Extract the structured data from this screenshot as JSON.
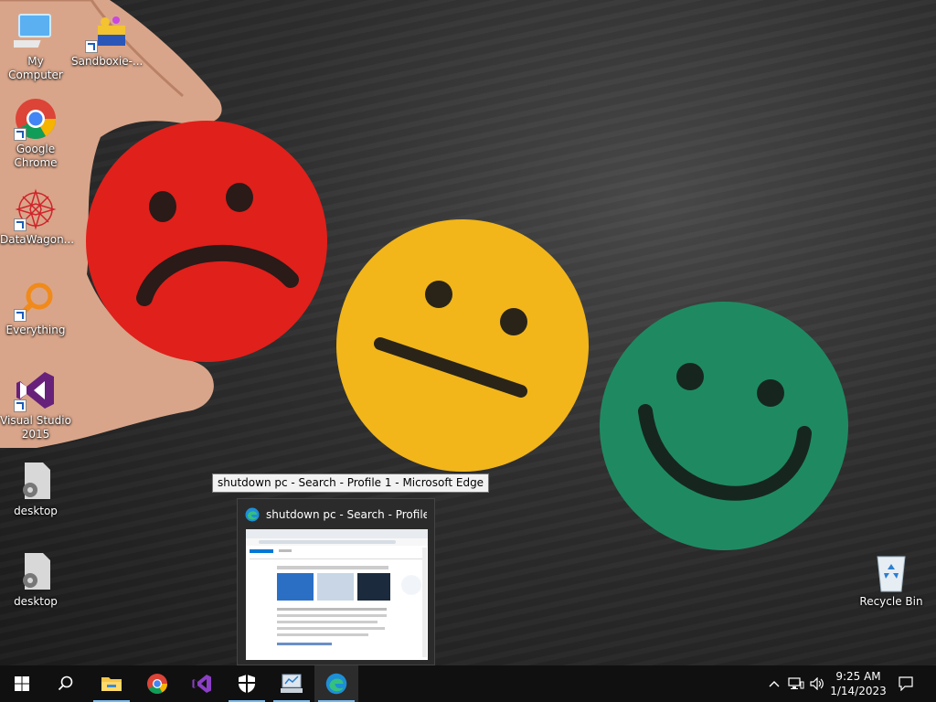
{
  "desktop_icons": [
    {
      "id": "my-computer",
      "label": "My Computer"
    },
    {
      "id": "sandboxie",
      "label": "Sandboxie-..."
    },
    {
      "id": "chrome",
      "label": "Google Chrome"
    },
    {
      "id": "datawagon",
      "label": "DataWagon..."
    },
    {
      "id": "everything",
      "label": "Everything"
    },
    {
      "id": "visual-studio",
      "label": "Visual Studio 2015"
    },
    {
      "id": "desktop-1",
      "label": "desktop"
    },
    {
      "id": "desktop-2",
      "label": "desktop"
    },
    {
      "id": "recycle-bin",
      "label": "Recycle Bin"
    }
  ],
  "tooltip": {
    "text": "shutdown pc - Search - Profile 1 - Microsoft Edge"
  },
  "preview": {
    "title": "shutdown pc - Search - Profile ...",
    "icon": "edge-icon"
  },
  "taskbar": {
    "items": [
      {
        "name": "start-button",
        "icon": "windows-logo-icon"
      },
      {
        "name": "search-button",
        "icon": "magnifier-icon"
      },
      {
        "name": "file-explorer",
        "icon": "folder-icon"
      },
      {
        "name": "chrome",
        "icon": "chrome-icon"
      },
      {
        "name": "visual-studio",
        "icon": "visual-studio-icon"
      },
      {
        "name": "windows-security",
        "icon": "shield-icon"
      },
      {
        "name": "control-panel",
        "icon": "control-panel-icon"
      },
      {
        "name": "edge",
        "icon": "edge-icon"
      }
    ],
    "clock": {
      "time": "9:25 AM",
      "date": "1/14/2023"
    }
  },
  "colors": {
    "taskbar": "#101010",
    "accent": "#76b9ed",
    "sad": "#e0201b",
    "neutral": "#f2b61b",
    "happy": "#1f8a62"
  }
}
